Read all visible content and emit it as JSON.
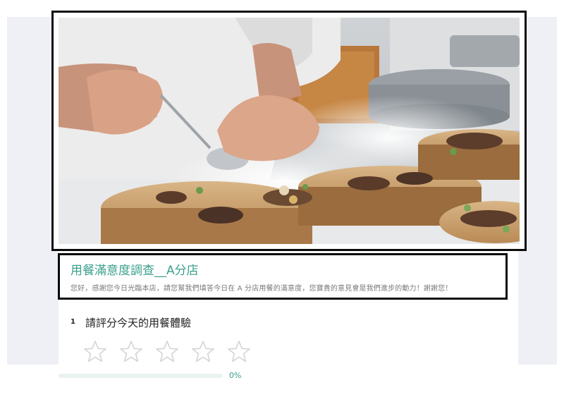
{
  "hero": {
    "image": "chef-plating-mushroom-dishes-on-wooden-slabs-photo"
  },
  "survey": {
    "title": "用餐滿意度調查__A分店",
    "description": "您好，感謝您今日光臨本店，請您幫我們填答今日在 A 分店用餐的滿意度，您寶貴的意見會是我們進步的動力！謝謝您！"
  },
  "question": {
    "number": "1",
    "text": "請評分今天的用餐體驗",
    "rating_max": 5,
    "rating_value": 0,
    "icon": "star-outline-icon"
  },
  "progress": {
    "value": 0,
    "label": "0%"
  },
  "colors": {
    "accent": "#3aa08c",
    "star": "#d4d4d4",
    "background": "#eff0f6"
  }
}
